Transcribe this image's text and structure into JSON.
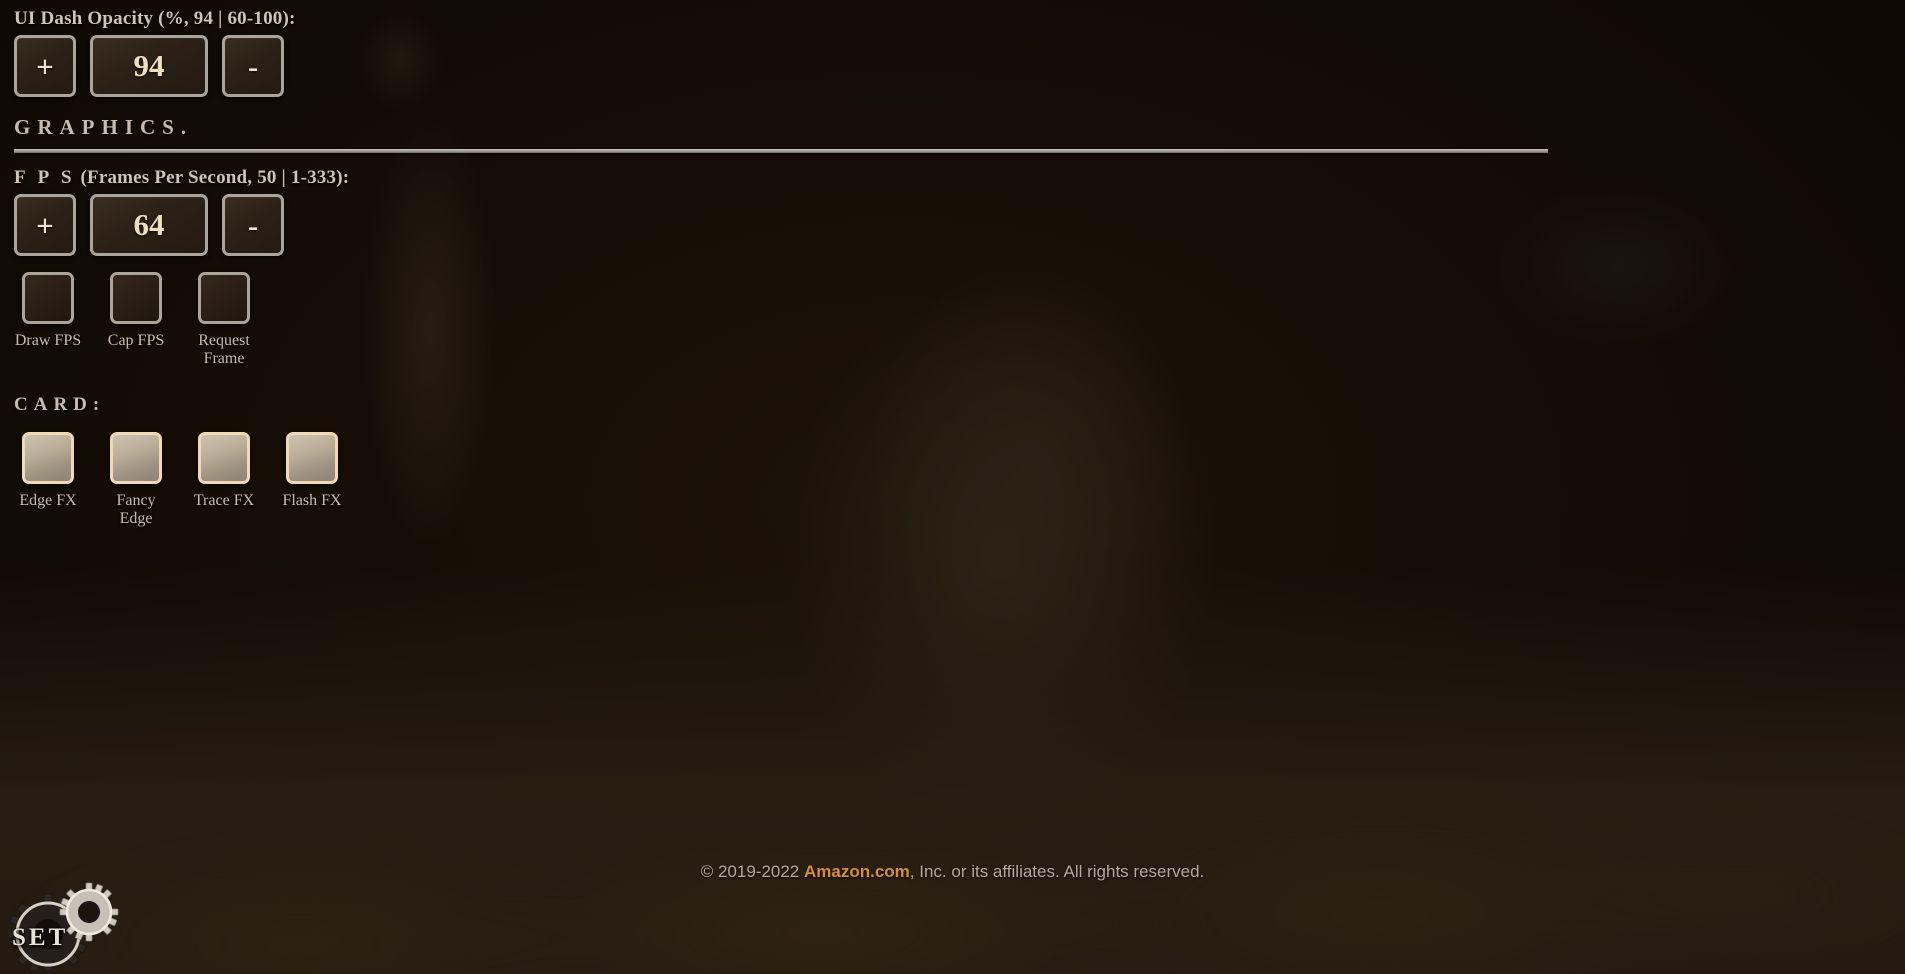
{
  "settings": {
    "opacity": {
      "label": "UI Dash Opacity (%, 94 | 60-100):",
      "value": "94",
      "increment_label": "+",
      "decrement_label": "-",
      "unit": "%",
      "current": 94,
      "min": 60,
      "max": 100
    },
    "graphics_section": {
      "heading": "GRAPHICS."
    },
    "fps": {
      "label_spaced": "F P S",
      "label_rest": " (Frames Per Second, 50 | 1-333):",
      "value": "64",
      "increment_label": "+",
      "decrement_label": "-",
      "default": 50,
      "current": 64,
      "min": 1,
      "max": 333
    },
    "fps_toggles": [
      {
        "label": "Draw FPS",
        "checked": false
      },
      {
        "label": "Cap FPS",
        "checked": false
      },
      {
        "label": "Request Frame",
        "checked": false
      }
    ],
    "card_section": {
      "heading": "CARD:"
    },
    "card_toggles": [
      {
        "label": "Edge FX",
        "checked": true
      },
      {
        "label": "Fancy Edge",
        "checked": true
      },
      {
        "label": "Trace FX",
        "checked": true
      },
      {
        "label": "Flash FX",
        "checked": true
      }
    ]
  },
  "footer": {
    "prefix": "© 2019-2022 ",
    "brand": "Amazon.com",
    "suffix": ", Inc. or its affiliates. All rights reserved."
  },
  "set_badge": {
    "label": "SET",
    "icon": "gears-icon"
  },
  "colors": {
    "accent_orange": "#d98f2b",
    "border_silver": "#a9a49c",
    "checked_border": "#f0d9b5",
    "text_cream": "#efe0c3",
    "background_brown": "#150d06"
  }
}
